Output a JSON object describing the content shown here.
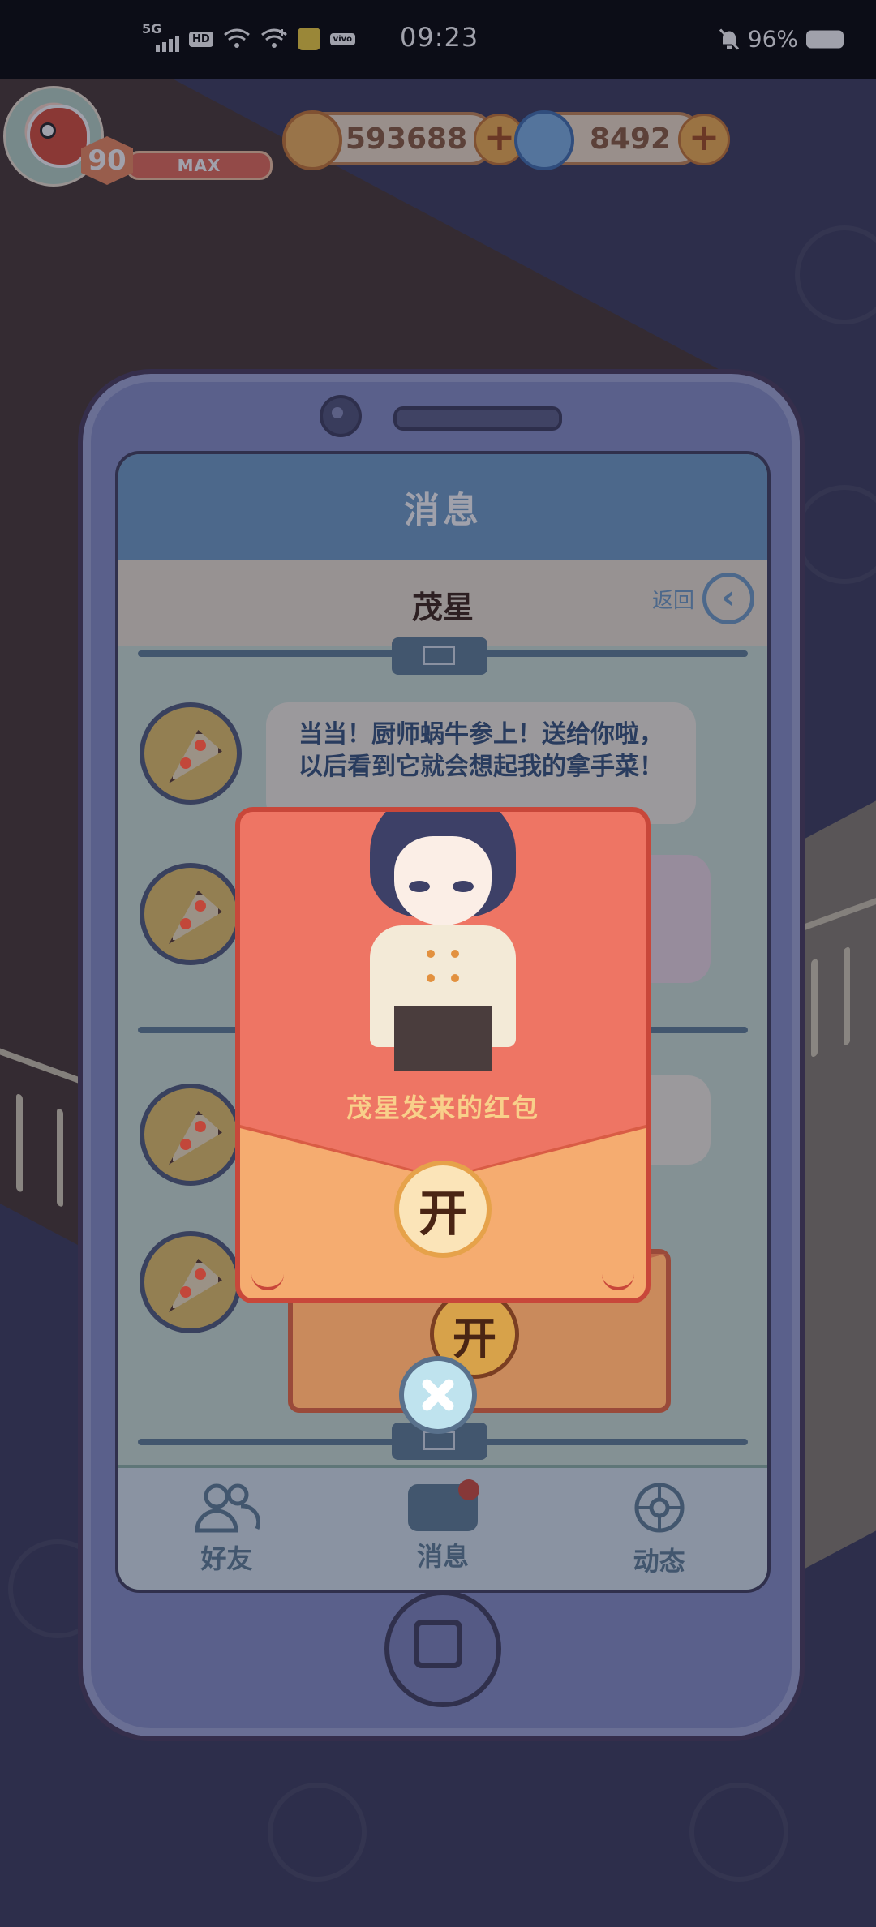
{
  "status_bar": {
    "network": "5G",
    "hd_label": "HD",
    "vivo_label": "vivo",
    "time": "09:23",
    "battery_percent": "96%"
  },
  "hud": {
    "level": "90",
    "level_status": "MAX",
    "coins": "593688",
    "gems": "8492",
    "coin_plus": "+",
    "gem_plus": "+"
  },
  "phone_screen": {
    "title": "消息",
    "contact_name": "茂星",
    "back_label": "返回",
    "back_icon_glyph": "‹",
    "messages": [
      {
        "text": "当当！厨师蜗牛参上！送给你啦，以后看到它就会想起我的拿手菜！"
      }
    ],
    "tabs": [
      {
        "label": "好友"
      },
      {
        "label": "消息",
        "has_notification": true
      },
      {
        "label": "动态"
      }
    ]
  },
  "red_packet": {
    "caption": "茂星发来的红包",
    "open_label": "开",
    "open_label_back": "开"
  },
  "colors": {
    "packet_red": "#ee7564",
    "packet_pocket": "#f5ac70",
    "screen_title": "#6f9ec8"
  }
}
